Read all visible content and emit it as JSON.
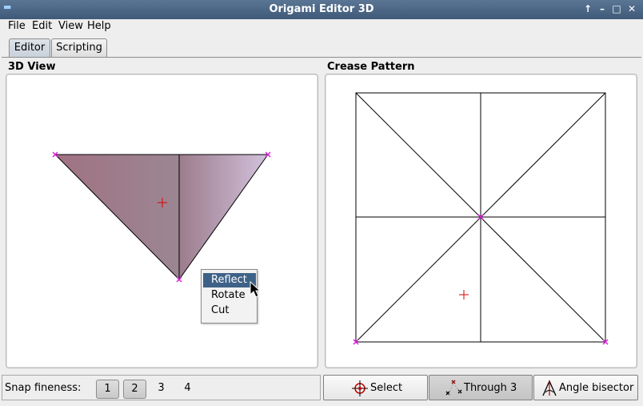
{
  "window": {
    "title": "Origami Editor 3D"
  },
  "menu": {
    "file": "File",
    "edit": "Edit",
    "view": "View",
    "help": "Help"
  },
  "tabs": {
    "editor": "Editor",
    "scripting": "Scripting"
  },
  "panes": {
    "view3d": "3D View",
    "crease": "Crease Pattern"
  },
  "context_menu": {
    "reflect": "Reflect",
    "rotate": "Rotate",
    "cut": "Cut"
  },
  "snap": {
    "label": "Snap fineness:",
    "options": [
      "1",
      "2",
      "3",
      "4"
    ]
  },
  "tools": {
    "select": "Select",
    "through3": "Through 3",
    "angle_bisector": "Angle bisector"
  },
  "colors": {
    "titlebar": "#4b6886",
    "selection": "#3e6287",
    "vertex": "#e020e0",
    "marker": "#e00000",
    "face_dark": "#9a7080",
    "face_light": "#cdbad6"
  }
}
